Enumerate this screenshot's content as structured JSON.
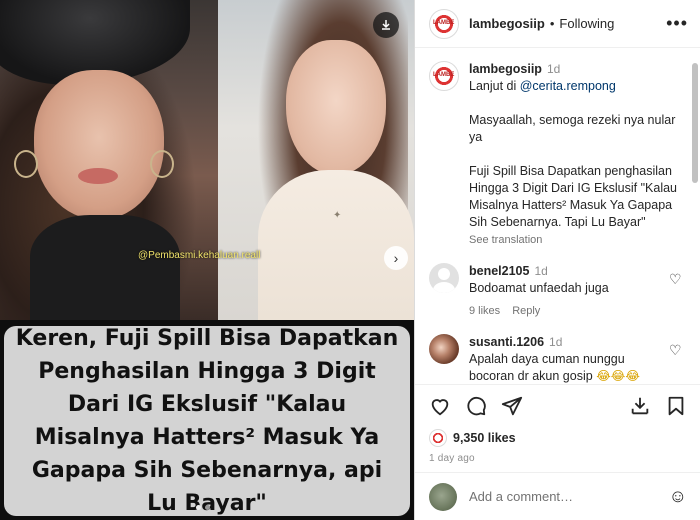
{
  "post": {
    "watermark": "@Pembasmi.kehaluan.reall",
    "headline": "Keren, Fuji Spill Bisa Dapatkan Penghasilan Hingga 3 Digit Dari IG Ekslusif \"Kalau Misalnya Hatters² Masuk Ya Gapapa Sih Sebenarnya, api Lu Bayar\"",
    "download_icon": "download-icon",
    "next_icon": "chevron-right-icon",
    "carousel_position": {
      "current": 1,
      "total": 2
    }
  },
  "header": {
    "username": "lambegosiip",
    "separator": "•",
    "follow_label": "Following",
    "more_label": "•••"
  },
  "caption": {
    "username": "lambegosiip",
    "time": "1d",
    "line1_prefix": "Lanjut di ",
    "mention": "@cerita.rempong",
    "para2": "Masyaallah, semoga rezeki nya nular ya",
    "para3": "Fuji Spill Bisa Dapatkan penghasilan Hingga 3 Digit Dari IG Ekslusif \"Kalau Misalnya Hatters² Masuk Ya Gapapa Sih Sebenarnya. Tapi Lu Bayar\"",
    "see_translation": "See translation"
  },
  "comments": [
    {
      "username": "benel2105",
      "time": "1d",
      "text": "Bodoamat unfaedah juga",
      "likes": "9 likes",
      "reply": "Reply"
    },
    {
      "username": "susanti.1206",
      "time": "1d",
      "text": "Apalah daya cuman nunggu bocoran dr akun gosip",
      "emojis": "😂😂😂",
      "likes": "",
      "reply": ""
    }
  ],
  "actions": {
    "likes": "9,350 likes",
    "ago": "1 day ago"
  },
  "add_comment": {
    "placeholder": "Add a comment…"
  }
}
